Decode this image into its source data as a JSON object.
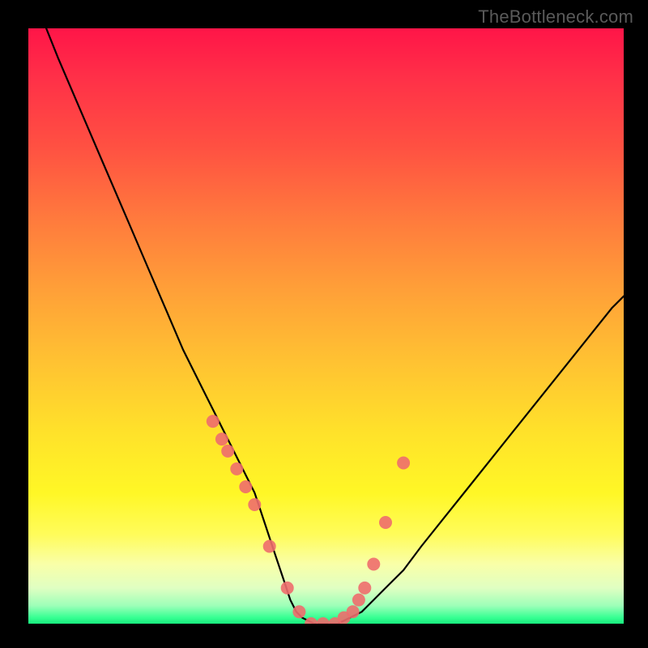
{
  "watermark": "TheBottleneck.com",
  "chart_data": {
    "type": "line",
    "title": "",
    "xlabel": "",
    "ylabel": "",
    "xlim": [
      0,
      100
    ],
    "ylim": [
      0,
      100
    ],
    "grid": false,
    "series": [
      {
        "name": "curve",
        "color": "#000000",
        "x": [
          3,
          5,
          8,
          11,
          14,
          17,
          20,
          23,
          26,
          29,
          32,
          34,
          36,
          38,
          39,
          40,
          41,
          42,
          43,
          44,
          45,
          46,
          48,
          50,
          52,
          54,
          56,
          58,
          60,
          63,
          66,
          70,
          74,
          78,
          82,
          86,
          90,
          94,
          98,
          100
        ],
        "y": [
          100,
          95,
          88,
          81,
          74,
          67,
          60,
          53,
          46,
          40,
          34,
          30,
          26,
          22,
          19,
          16,
          13,
          10,
          7,
          4,
          2,
          1,
          0,
          0,
          0,
          1,
          2,
          4,
          6,
          9,
          13,
          18,
          23,
          28,
          33,
          38,
          43,
          48,
          53,
          55
        ]
      },
      {
        "name": "markers",
        "type": "scatter",
        "color": "#ee6d6d",
        "x": [
          31,
          32.5,
          33.5,
          35,
          36.5,
          38,
          40.5,
          43.5,
          45.5,
          47.5,
          49.5,
          51.5,
          53,
          54.5,
          55.5,
          56.5,
          58,
          60,
          63
        ],
        "y": [
          34,
          31,
          29,
          26,
          23,
          20,
          13,
          6,
          2,
          0,
          0,
          0,
          1,
          2,
          4,
          6,
          10,
          17,
          27
        ]
      }
    ],
    "background_gradient": {
      "type": "vertical",
      "stops": [
        {
          "pos": 0.0,
          "color": "#ff1548"
        },
        {
          "pos": 0.2,
          "color": "#ff5142"
        },
        {
          "pos": 0.4,
          "color": "#ff9a3a"
        },
        {
          "pos": 0.6,
          "color": "#ffd22e"
        },
        {
          "pos": 0.78,
          "color": "#fff726"
        },
        {
          "pos": 0.9,
          "color": "#f9ffa8"
        },
        {
          "pos": 0.97,
          "color": "#9cffb8"
        },
        {
          "pos": 1.0,
          "color": "#18e97c"
        }
      ]
    }
  }
}
